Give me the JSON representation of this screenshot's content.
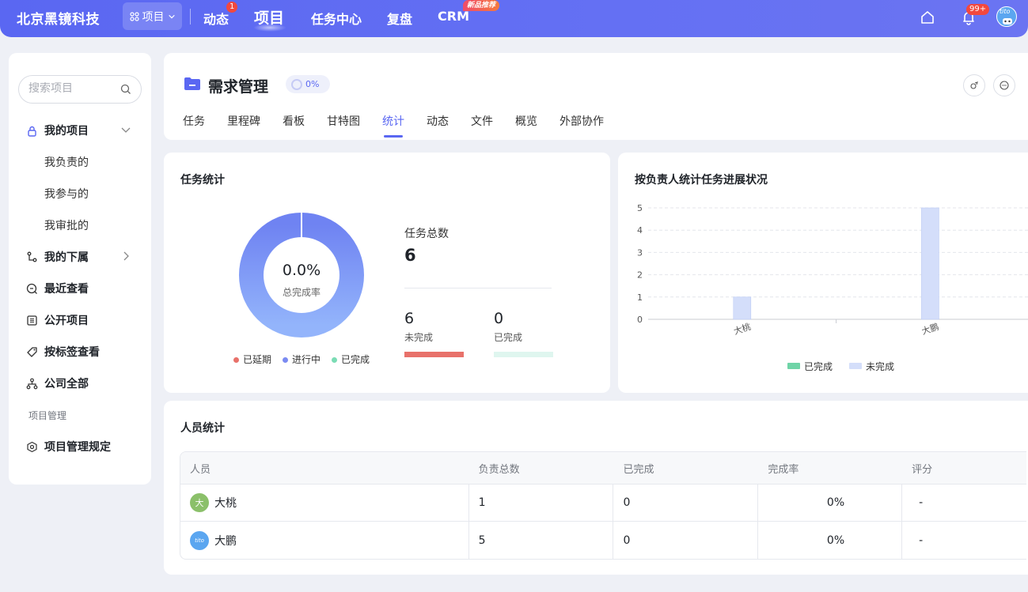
{
  "topbar": {
    "brand": "北京黑镜科技",
    "project_switch": "项目",
    "nav": [
      {
        "label": "动态",
        "badge": "1"
      },
      {
        "label": "项目"
      },
      {
        "label": "任务中心"
      },
      {
        "label": "复盘"
      },
      {
        "label": "CRM",
        "promo": "新品推荐"
      }
    ],
    "notify_badge": "99+",
    "avatar_text": "tito"
  },
  "sidebar": {
    "search_placeholder": "搜索项目",
    "my_projects": "我的项目",
    "sub_items": [
      "我负责的",
      "我参与的",
      "我审批的"
    ],
    "subordinates": "我的下属",
    "recent": "最近查看",
    "public": "公开项目",
    "by_tag": "按标签查看",
    "company_all": "公司全部",
    "caption": "项目管理",
    "rules": "项目管理规定"
  },
  "project": {
    "title": "需求管理",
    "progress": "0%",
    "tabs": [
      "任务",
      "里程碑",
      "看板",
      "甘特图",
      "统计",
      "动态",
      "文件",
      "概览",
      "外部协作"
    ],
    "active_tab": "统计"
  },
  "task_stats": {
    "title": "任务统计",
    "rate": "0.0%",
    "rate_label": "总完成率",
    "total_label": "任务总数",
    "total": "6",
    "unfinished_num": "6",
    "unfinished_label": "未完成",
    "finished_num": "0",
    "finished_label": "已完成",
    "legend": [
      {
        "label": "已延期",
        "color": "#e8716a"
      },
      {
        "label": "进行中",
        "color": "#7b8bf2"
      },
      {
        "label": "已完成",
        "color": "#7bdcb5"
      }
    ],
    "colors": {
      "ring_top": "#6f83f2",
      "ring_bottom": "#93b4fb",
      "unfinished_bar": "#e8716a",
      "finished_bar": "#dff6ef"
    }
  },
  "chart_data": {
    "type": "bar",
    "title": "按负责人统计任务进展状况",
    "categories": [
      "大桃",
      "大鹏"
    ],
    "series": [
      {
        "name": "已完成",
        "values": [
          0,
          0
        ],
        "color": "#6fd4a7"
      },
      {
        "name": "未完成",
        "values": [
          1,
          5
        ],
        "color": "#d4defa"
      }
    ],
    "ylim": [
      0,
      5
    ],
    "yticks": [
      "0",
      "1",
      "2",
      "3",
      "4",
      "5"
    ],
    "grid": true,
    "legend_position": "bottom"
  },
  "people": {
    "title": "人员统计",
    "headers": [
      "人员",
      "负责总数",
      "已完成",
      "完成率",
      "评分"
    ],
    "rows": [
      {
        "name": "大桃",
        "avatar": "大",
        "avatar_color": "#8bc06a",
        "total": "1",
        "done": "0",
        "rate": "0%",
        "score": "-"
      },
      {
        "name": "大鹏",
        "avatar": "tito",
        "avatar_color": "#5ba6f0",
        "total": "5",
        "done": "0",
        "rate": "0%",
        "score": "-"
      }
    ]
  }
}
